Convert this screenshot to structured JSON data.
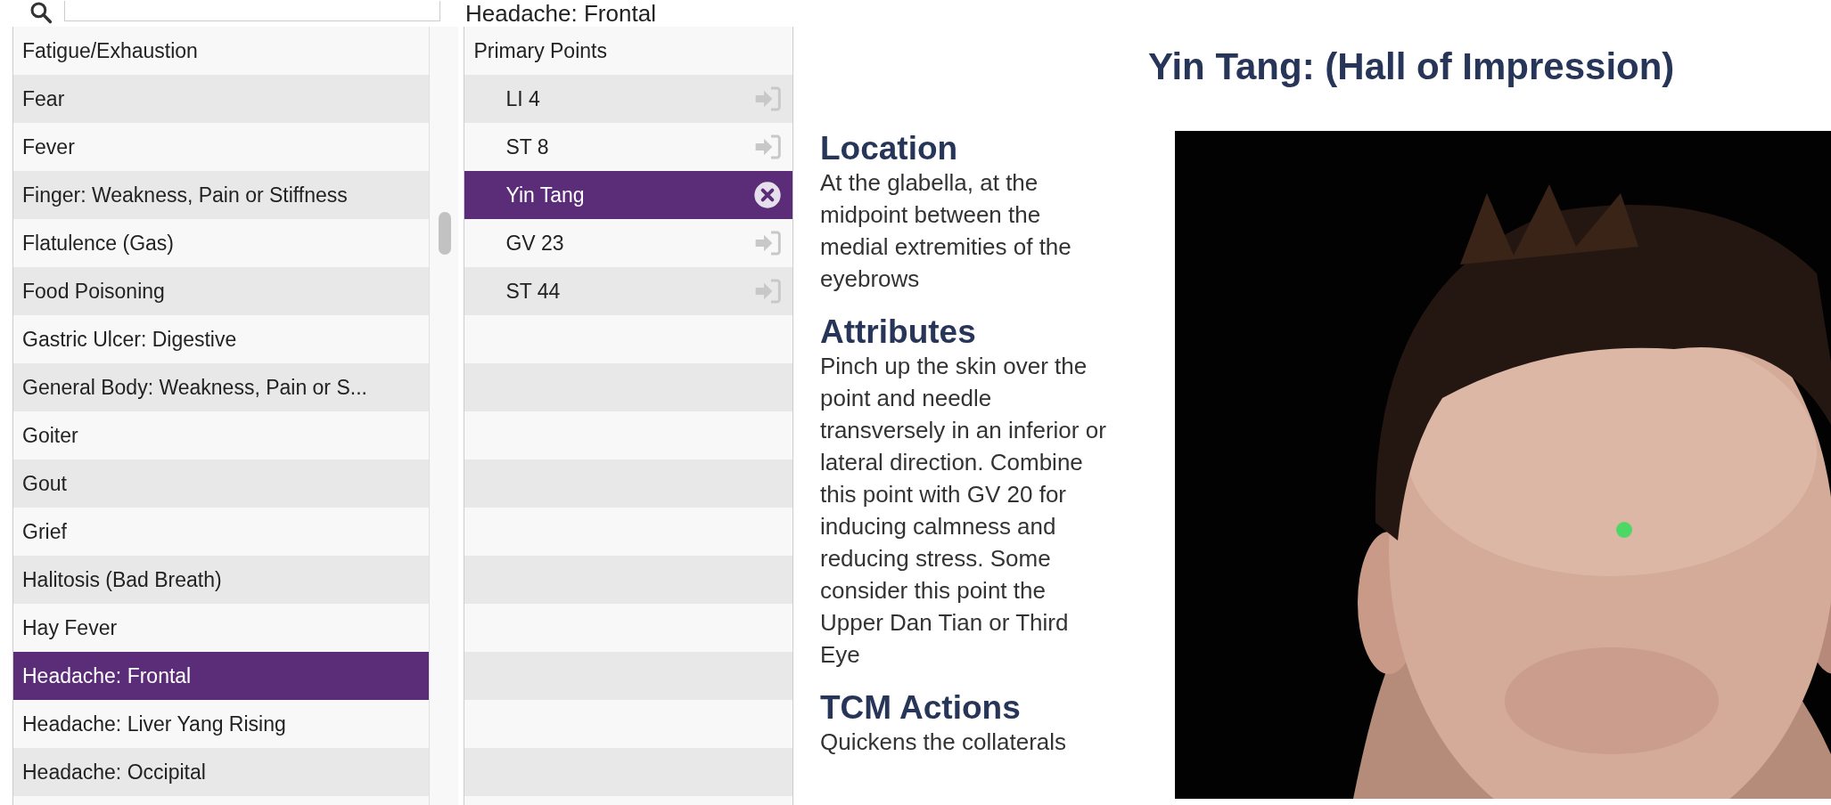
{
  "condition_title": "Headache: Frontal",
  "conditions": [
    {
      "label": "Fatigue/Exhaustion",
      "selected": false
    },
    {
      "label": "Fear",
      "selected": false
    },
    {
      "label": "Fever",
      "selected": false
    },
    {
      "label": "Finger: Weakness, Pain or Stiffness",
      "selected": false
    },
    {
      "label": "Flatulence (Gas)",
      "selected": false
    },
    {
      "label": "Food Poisoning",
      "selected": false
    },
    {
      "label": "Gastric Ulcer: Digestive",
      "selected": false
    },
    {
      "label": "General Body: Weakness, Pain or S...",
      "selected": false
    },
    {
      "label": "Goiter",
      "selected": false
    },
    {
      "label": "Gout",
      "selected": false
    },
    {
      "label": "Grief",
      "selected": false
    },
    {
      "label": "Halitosis (Bad Breath)",
      "selected": false
    },
    {
      "label": "Hay Fever",
      "selected": false
    },
    {
      "label": "Headache: Frontal",
      "selected": true
    },
    {
      "label": "Headache: Liver Yang Rising",
      "selected": false
    },
    {
      "label": "Headache: Occipital",
      "selected": false
    }
  ],
  "points_header": "Primary Points",
  "points": [
    {
      "label": "LI 4",
      "selected": false
    },
    {
      "label": "ST 8",
      "selected": false
    },
    {
      "label": "Yin Tang",
      "selected": true
    },
    {
      "label": "GV 23",
      "selected": false
    },
    {
      "label": "ST 44",
      "selected": false
    }
  ],
  "detail": {
    "title": "Yin Tang: (Hall of Impression)",
    "sections": [
      {
        "heading": "Location",
        "text": "At the glabella, at the midpoint between the medial extremities of the eyebrows"
      },
      {
        "heading": "Attributes",
        "text": "Pinch up the skin over the point and needle transversely in an inferior or lateral direction. Combine this point with GV 20 for inducing calmness and reducing stress. Some consider this point the Upper Dan Tian or Third Eye"
      },
      {
        "heading": "TCM Actions",
        "text": "Quickens the collaterals"
      }
    ]
  }
}
